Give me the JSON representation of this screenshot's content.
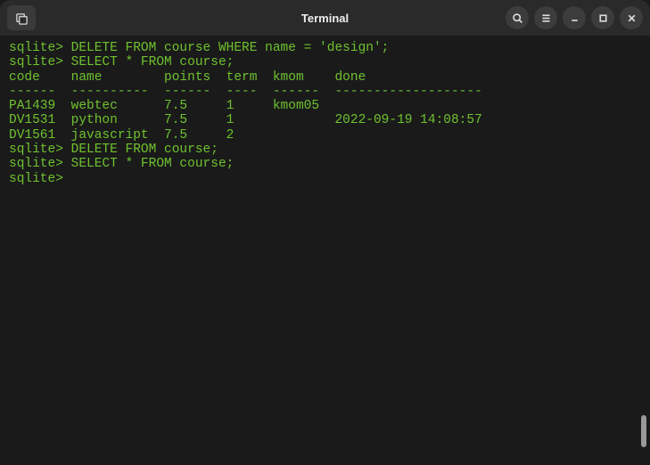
{
  "window": {
    "title": "Terminal"
  },
  "terminal": {
    "lines": [
      "sqlite> DELETE FROM course WHERE name = 'design';",
      "sqlite> SELECT * FROM course;",
      "code    name        points  term  kmom    done",
      "------  ----------  ------  ----  ------  -------------------",
      "PA1439  webtec      7.5     1     kmom05",
      "DV1531  python      7.5     1             2022-09-19 14:08:57",
      "DV1561  javascript  7.5     2",
      "sqlite> DELETE FROM course;",
      "sqlite> SELECT * FROM course;",
      "sqlite> "
    ]
  },
  "chart_data": {
    "type": "table",
    "title": "SELECT * FROM course",
    "columns": [
      "code",
      "name",
      "points",
      "term",
      "kmom",
      "done"
    ],
    "rows": [
      {
        "code": "PA1439",
        "name": "webtec",
        "points": 7.5,
        "term": 1,
        "kmom": "kmom05",
        "done": ""
      },
      {
        "code": "DV1531",
        "name": "python",
        "points": 7.5,
        "term": 1,
        "kmom": "",
        "done": "2022-09-19 14:08:57"
      },
      {
        "code": "DV1561",
        "name": "javascript",
        "points": 7.5,
        "term": 2,
        "kmom": "",
        "done": ""
      }
    ],
    "sql_commands": [
      "DELETE FROM course WHERE name = 'design';",
      "SELECT * FROM course;",
      "DELETE FROM course;",
      "SELECT * FROM course;"
    ]
  }
}
